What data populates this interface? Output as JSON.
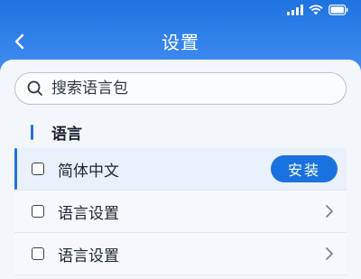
{
  "status": {
    "icons": [
      "signal-icon",
      "wifi-icon",
      "battery-icon"
    ]
  },
  "header": {
    "title": "设置",
    "back_icon": "chevron-left-icon"
  },
  "search": {
    "placeholder": "搜索语言包",
    "value": ""
  },
  "section": {
    "title": "语言"
  },
  "items": [
    {
      "label": "简体中文",
      "action": "安装",
      "checked": false,
      "selected": true
    },
    {
      "label": "语言设置",
      "checked": false
    },
    {
      "label": "语言设置",
      "checked": false
    }
  ],
  "colors": {
    "accent": "#1a72df",
    "header_bg": "#1f73e0",
    "panel_bg": "#f3f6fb"
  }
}
